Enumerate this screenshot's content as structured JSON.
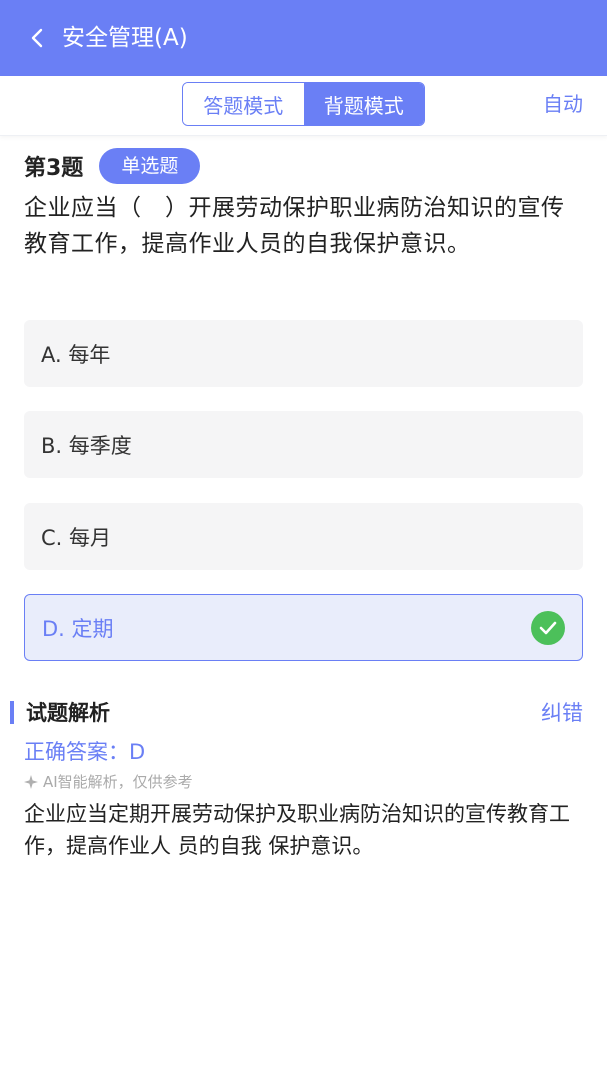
{
  "header": {
    "title": "安全管理(A)"
  },
  "mode_bar": {
    "answer_mode_label": "答题模式",
    "recite_mode_label": "背题模式",
    "auto_label": "自动"
  },
  "question": {
    "number_label": "第3题",
    "type_label": "单选题",
    "text": "企业应当（　）开展劳动保护职业病防治知识的宣传教育工作，提高作业人员的自我保护意识。",
    "options": [
      {
        "label": "A. 每年"
      },
      {
        "label": "B. 每季度"
      },
      {
        "label": "C. 每月"
      },
      {
        "label": "D. 定期",
        "correct": true
      }
    ]
  },
  "analysis": {
    "title": "试题解析",
    "report_error_label": "纠错",
    "correct_answer": "正确答案：D",
    "ai_note": "AI智能解析，仅供参考",
    "text": "企业应当定期开展劳动保护及职业病防治知识的宣传教育工作，提高作业人 员的自我 保护意识。"
  },
  "colors": {
    "primary": "#6a7ff5",
    "correct_check": "#4cc05a",
    "option_bg": "#f5f5f6"
  }
}
